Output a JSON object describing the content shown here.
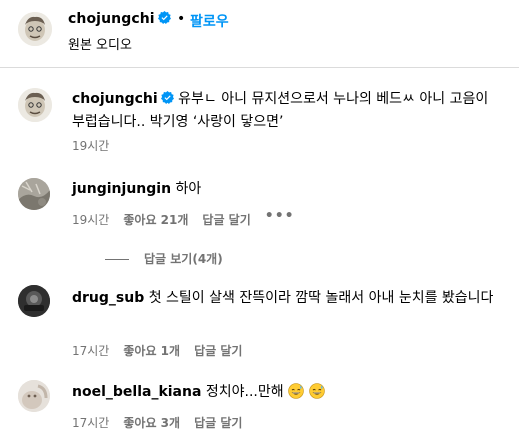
{
  "header": {
    "username": "chojungchi",
    "separator": "•",
    "follow_label": "팔로우",
    "audio_label": "원본 오디오"
  },
  "caption": {
    "username": "chojungchi",
    "text": "유부ㄴ 아니 뮤지션으로서 누나의 베드ㅆ 아니 고음이 부럽습니다.. 박기영 ‘사랑이 닿으면’",
    "time": "19시간"
  },
  "comments": [
    {
      "username": "junginjungin",
      "text": "하아",
      "time": "19시간",
      "likes": "좋아요 21개",
      "reply_label": "답글 달기",
      "more": "•••"
    },
    {
      "username": "drug_sub",
      "text": "첫 스틸이 살색 잔뜩이라 깜딱 놀래서 아내 눈치를 봤습니다",
      "time": "17시간",
      "likes": "좋아요 1개",
      "reply_label": "답글 달기"
    },
    {
      "username": "noel_bella_kiana",
      "text": "정치야...만해",
      "time": "17시간",
      "likes": "좋아요 3개",
      "reply_label": "답글 달기"
    }
  ],
  "view_replies_label": "답글 보기(4개)",
  "colors": {
    "follow": "#0095f6",
    "verified": "#0095f6",
    "secondary_text": "#737373"
  },
  "icons": {
    "verified": "verified-badge-icon",
    "more": "more-options-icon",
    "emoji": "grinning-sweat-emoji"
  }
}
